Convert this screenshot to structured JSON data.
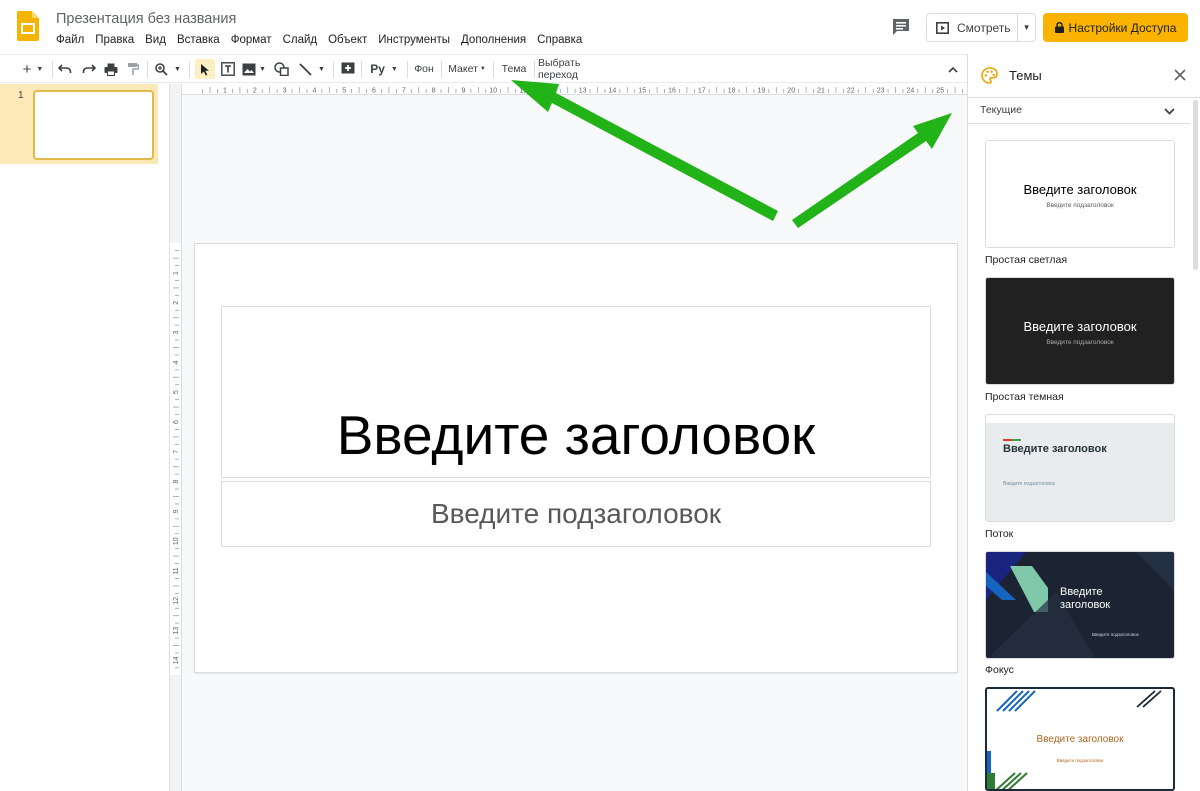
{
  "header": {
    "doc_title": "Презентация без названия",
    "menu": [
      "Файл",
      "Правка",
      "Вид",
      "Вставка",
      "Формат",
      "Слайд",
      "Объект",
      "Инструменты",
      "Дополнения",
      "Справка"
    ],
    "present_label": "Смотреть",
    "share_label": "Настройки Доступа",
    "share_color": "#f9b300"
  },
  "toolbar": {
    "background_label": "Фон",
    "layout_label": "Макет",
    "theme_label": "Тема",
    "transition_label": "Выбрать переход",
    "language_label": "Py"
  },
  "rulers": {
    "horizontal_ticks": [
      "1",
      "2",
      "3",
      "4",
      "5",
      "6",
      "7",
      "8",
      "9",
      "10",
      "11",
      "12",
      "13",
      "14",
      "15",
      "16",
      "17",
      "18",
      "19",
      "20",
      "21",
      "22",
      "23",
      "24",
      "25"
    ],
    "vertical_ticks": [
      "1",
      "2",
      "3",
      "4",
      "5",
      "6",
      "7",
      "8",
      "9",
      "10",
      "11",
      "12",
      "13",
      "14"
    ]
  },
  "filmstrip": {
    "slide_number": "1"
  },
  "slide": {
    "title_placeholder": "Введите заголовок",
    "subtitle_placeholder": "Введите подзаголовок"
  },
  "themes_panel": {
    "title": "Темы",
    "filter_label": "Текущие",
    "themes": [
      {
        "name": "Простая светлая",
        "title": "Введите заголовок",
        "subtitle": "Введите подзаголовок",
        "bg": "#ffffff"
      },
      {
        "name": "Простая темная",
        "title": "Введите заголовок",
        "subtitle": "Введите подзаголовок",
        "bg": "#212121"
      },
      {
        "name": "Поток",
        "title": "Введите заголовок",
        "subtitle": "Введите подзаголовок",
        "bg": "#eceff1"
      },
      {
        "name": "Фокус",
        "title": "Введите\nзаголовок",
        "subtitle": "Введите подзаголовок",
        "bg": "#1c2433"
      },
      {
        "name": "",
        "title": "Введите заголовок",
        "subtitle": "Введите подзаголовок",
        "bg": "#ffffff"
      }
    ]
  },
  "annotation_color": "#22b318"
}
